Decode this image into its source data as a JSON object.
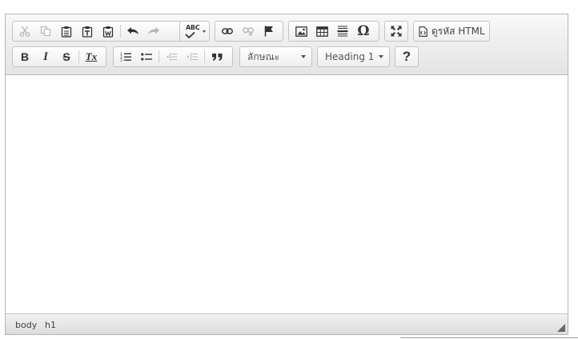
{
  "toolbar": {
    "row1": {
      "clipboard": [
        "cut-icon",
        "copy-icon",
        "paste-icon",
        "paste-text-icon",
        "paste-from-word-icon"
      ],
      "history": [
        "undo-icon",
        "redo-icon"
      ],
      "spellcheck_label": "ABC",
      "links": [
        "link-icon",
        "unlink-icon",
        "anchor-flag-icon"
      ],
      "insert": [
        "image-icon",
        "table-icon",
        "horizontal-line-icon",
        "special-character-icon"
      ],
      "special_char_glyph": "Ω",
      "maximize": "maximize-icon",
      "source_label": "ดูรหัส HTML"
    },
    "row2": {
      "bold_label": "B",
      "italic_label": "I",
      "strike_label": "S",
      "remove_format_label": "Tx",
      "lists": [
        "numbered-list-icon",
        "bulleted-list-icon"
      ],
      "indent": [
        "decrease-indent-icon",
        "increase-indent-icon"
      ],
      "blockquote_glyph": "❞",
      "styles_combo": "ลักษณะ",
      "format_combo": "Heading 1",
      "help_label": "?"
    }
  },
  "statusbar": {
    "path": [
      "body",
      "h1"
    ]
  },
  "colors": {
    "toolbar_bg": "#e9e9e9",
    "border": "#b6b6b6",
    "icon": "#333333",
    "icon_disabled": "#b8b8b8"
  }
}
